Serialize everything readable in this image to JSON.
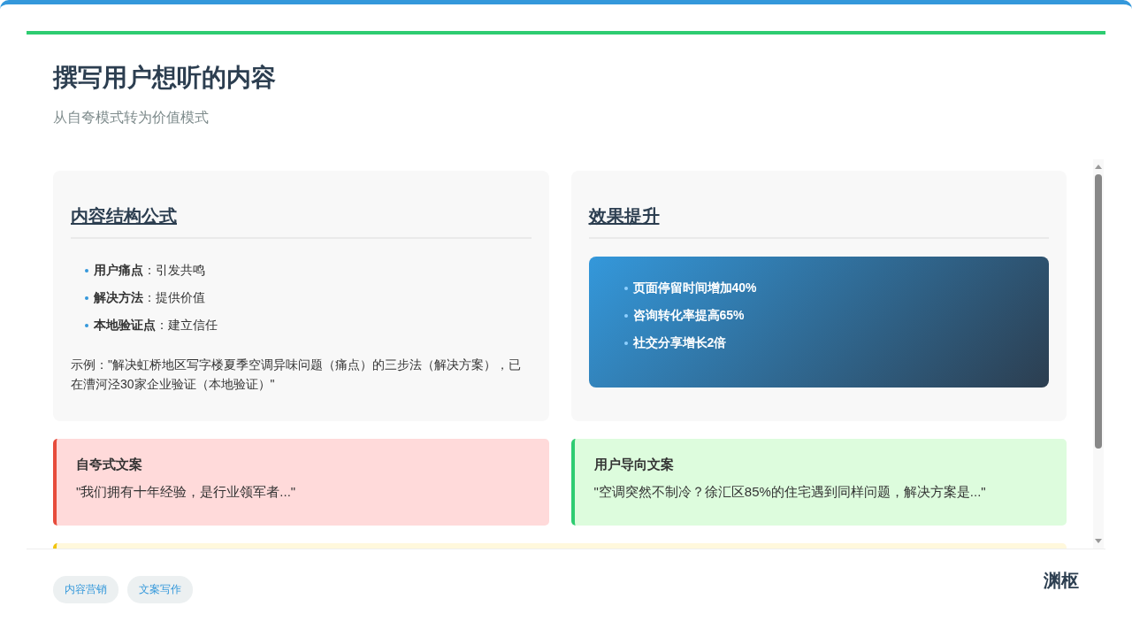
{
  "header": {
    "title": "撰写用户想听的内容",
    "subtitle": "从自夸模式转为价值模式"
  },
  "formula_card": {
    "heading": "内容结构公式",
    "items": [
      {
        "term": "用户痛点",
        "text": "：引发共鸣"
      },
      {
        "term": "解决方法",
        "text": "：提供价值"
      },
      {
        "term": "本地验证点",
        "text": "：建立信任"
      }
    ],
    "example": "示例：\"解决虹桥地区写字楼夏季空调异味问题（痛点）的三步法（解决方案），已在漕河泾30家企业验证（本地验证）\""
  },
  "results_card": {
    "heading": "效果提升",
    "stats": [
      "页面停留时间增加40%",
      "咨询转化率提高65%",
      "社交分享增长2倍"
    ]
  },
  "comparisons": [
    {
      "kind": "negative",
      "title": "自夸式文案",
      "quote": "\"我们拥有十年经验，是行业领军者...\""
    },
    {
      "kind": "positive",
      "title": "用户导向文案",
      "quote": "\"空调突然不制冷？徐汇区85%的住宅遇到同样问题，解决方案是...\""
    }
  ],
  "footer": {
    "tags": [
      "内容营销",
      "文案写作"
    ],
    "brand": "渊枢"
  }
}
